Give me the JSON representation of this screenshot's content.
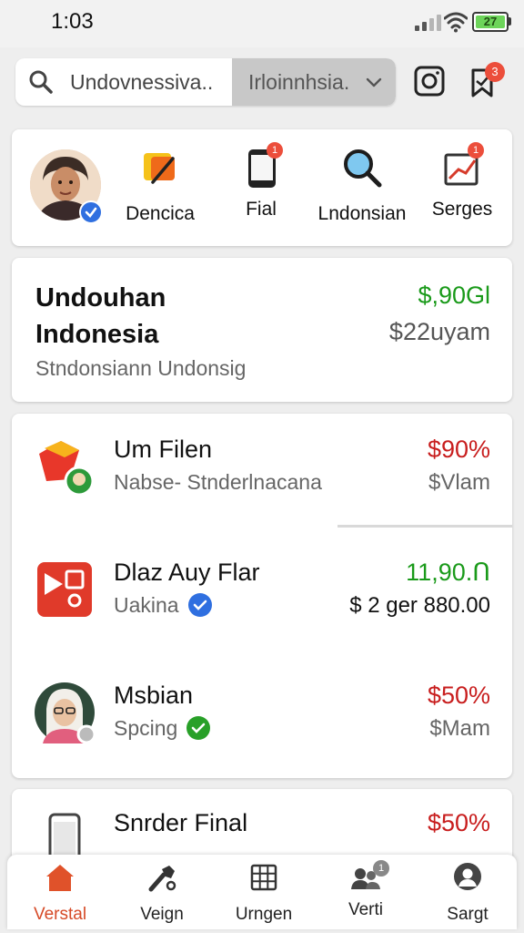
{
  "status": {
    "time": "1:03",
    "battery": "27"
  },
  "search": {
    "query": "Undovnessiva..",
    "select_value": "Irloinnhsia."
  },
  "notifications": {
    "count": "3"
  },
  "shortcuts": [
    {
      "label": "Dencica",
      "icon": "edit-icon"
    },
    {
      "label": "Fial",
      "icon": "tablet-icon",
      "badge": "1"
    },
    {
      "label": "Lndonsian",
      "icon": "magnifier-icon"
    },
    {
      "label": "Serges",
      "icon": "chart-icon",
      "badge": "1"
    }
  ],
  "summary": {
    "title": "Undouhan Indonesia",
    "subtitle": "Stndonsiann Undonsig",
    "value": "$,90Gl",
    "value2": "$22uyam"
  },
  "items": [
    {
      "title": "Um Filen",
      "subtitle": "Nabse- Stnderlnacana",
      "value": "$90%",
      "value2": "$Vlam",
      "value_color": "#c81e1e"
    },
    {
      "title": "Dlaz Auy Flar",
      "subtitle": "Uakina",
      "value": "11,90.Ո",
      "value2": "$ 2 ger  880.00",
      "value_color": "#1a9a1a"
    },
    {
      "title": "Msbian",
      "subtitle": "Spcing",
      "value": "$50%",
      "value2": "$Mam",
      "value_color": "#c81e1e"
    }
  ],
  "partial_item": {
    "title": "Snrder Final",
    "value": "$50%",
    "value_color": "#c81e1e"
  },
  "nav": [
    {
      "label": "Verstal",
      "icon": "home-icon",
      "active": true
    },
    {
      "label": "Veign",
      "icon": "tools-icon"
    },
    {
      "label": "Urngen",
      "icon": "grid-icon"
    },
    {
      "label": "Verti",
      "icon": "people-icon",
      "badge": "1"
    },
    {
      "label": "Sargt",
      "icon": "profile-icon"
    }
  ],
  "colors": {
    "accent": "#d64a27",
    "positive": "#1a9a1a",
    "negative": "#c81e1e",
    "badge": "#ec4e3b"
  }
}
